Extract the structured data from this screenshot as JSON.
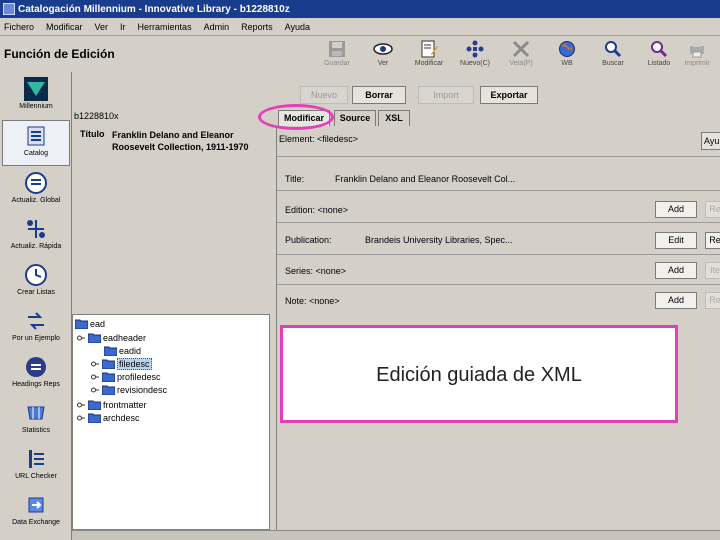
{
  "window": {
    "title": "Catalogación Millennium - Innovative Library - b1228810z"
  },
  "menu": [
    "Fichero",
    "Modificar",
    "Ver",
    "Ir",
    "Herramientas",
    "Admin",
    "Reports",
    "Ayuda"
  ],
  "page_title": "Función de Edición",
  "toolbar": [
    {
      "label": "Guardar",
      "icon": "save-icon",
      "enabled": false
    },
    {
      "label": "Ver",
      "icon": "eye-icon",
      "enabled": true
    },
    {
      "label": "Modificar",
      "icon": "edit-document-icon",
      "enabled": true
    },
    {
      "label": "Nuevo(C)",
      "icon": "new-record-icon",
      "enabled": true
    },
    {
      "label": "Veta(P)",
      "icon": "link-icon",
      "enabled": false
    },
    {
      "label": "WB",
      "icon": "globe-icon",
      "enabled": true
    },
    {
      "label": "Buscar",
      "icon": "search-icon",
      "enabled": true
    },
    {
      "label": "Listado",
      "icon": "search-list-icon",
      "enabled": true
    },
    {
      "label": "Imprimir",
      "icon": "print-icon",
      "enabled": false
    }
  ],
  "sidebar": [
    {
      "label": "Millennium",
      "icon": "millennium-logo-icon"
    },
    {
      "label": "Catalog",
      "icon": "catalog-icon",
      "active": true
    },
    {
      "label": "Actualiz. Global",
      "icon": "global-update-icon"
    },
    {
      "label": "Actualiz. Rápida",
      "icon": "rapid-update-icon"
    },
    {
      "label": "Crear Listas",
      "icon": "create-lists-icon"
    },
    {
      "label": "Por un Ejemplo",
      "icon": "by-example-icon"
    },
    {
      "label": "Headings Reps",
      "icon": "headings-reports-icon"
    },
    {
      "label": "Statistics",
      "icon": "statistics-icon"
    },
    {
      "label": "URL Checker",
      "icon": "url-checker-icon"
    },
    {
      "label": "Data Exchange",
      "icon": "data-exchange-icon"
    }
  ],
  "actions": [
    {
      "label": "Nuevo",
      "enabled": false
    },
    {
      "label": "Borrar",
      "enabled": true
    },
    {
      "label": "Import",
      "enabled": false
    },
    {
      "label": "Exportar",
      "enabled": true
    }
  ],
  "record": {
    "id": "b1228810x",
    "title_label": "Título",
    "title_value": "Franklin Delano and Eleanor Roosevelt Collection, 1911-1970"
  },
  "tabs": [
    {
      "label": "Modificar",
      "active": true
    },
    {
      "label": "Source",
      "active": false
    },
    {
      "label": "XSL",
      "active": false
    }
  ],
  "tree": [
    {
      "label": "ead",
      "level": 0,
      "toggle": false
    },
    {
      "label": "eadheader",
      "level": 1,
      "toggle": true
    },
    {
      "label": "eadid",
      "level": 2,
      "toggle": false
    },
    {
      "label": "filedesc",
      "level": 2,
      "toggle": true,
      "selected": true
    },
    {
      "label": "profiledesc",
      "level": 2,
      "toggle": true
    },
    {
      "label": "revisiondesc",
      "level": 2,
      "toggle": true
    },
    {
      "label": "frontmatter",
      "level": 1,
      "toggle": true
    },
    {
      "label": "archdesc",
      "level": 1,
      "toggle": true
    }
  ],
  "editor": {
    "element_label": "Element: <filedesc>",
    "help_label": "Ayu",
    "fields": [
      {
        "label": "Title:",
        "value": "Franklin Delano and Eleanor Roosevelt Col...",
        "button": "",
        "extra": ""
      },
      {
        "label": "Edition: <none>",
        "value": "",
        "button": "Add",
        "extra": "Re"
      },
      {
        "label": "Publication:",
        "value": "Brandeis University Libraries, Spec...",
        "button": "Edit",
        "extra": "Re"
      },
      {
        "label": "Series: <none>",
        "value": "",
        "button": "Add",
        "extra": "Ite"
      },
      {
        "label": "Note: <none>",
        "value": "",
        "button": "Add",
        "extra": "Re"
      }
    ]
  },
  "annotation": {
    "caption": "Edición guiada de XML",
    "color": "#e23fb9"
  }
}
